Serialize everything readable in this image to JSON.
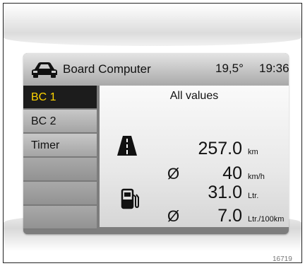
{
  "header": {
    "icon": "car-icon",
    "title": "Board Computer",
    "temperature": "19,5°",
    "time": "19:36"
  },
  "sidebar": {
    "items": [
      {
        "label": "BC 1",
        "active": true
      },
      {
        "label": "BC 2",
        "active": false
      },
      {
        "label": "Timer",
        "active": false
      },
      {
        "label": "",
        "active": false
      },
      {
        "label": "",
        "active": false
      },
      {
        "label": "",
        "active": false
      }
    ]
  },
  "content": {
    "title": "All values",
    "distance": {
      "icon": "road-icon",
      "value": "257.0",
      "unit": "km"
    },
    "avg_speed": {
      "symbol": "Ø",
      "value": "40",
      "unit": "km/h"
    },
    "fuel": {
      "icon": "fuel-pump-icon",
      "value": "31.0",
      "unit": "Ltr."
    },
    "avg_consumption": {
      "symbol": "Ø",
      "value": "7.0",
      "unit": "Ltr./100km"
    }
  },
  "reference_number": "16719",
  "colors": {
    "active_text": "#ffd400",
    "active_bg": "#1c1c1c"
  }
}
